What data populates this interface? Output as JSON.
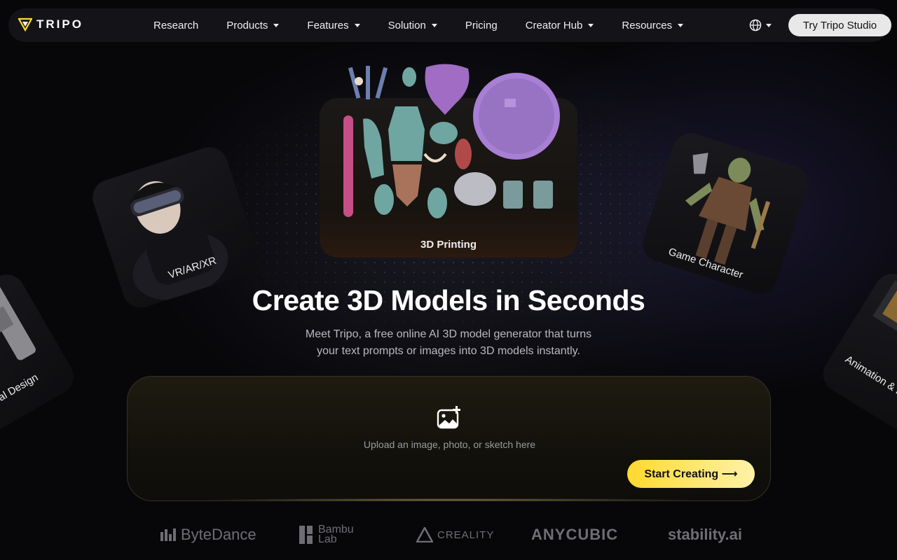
{
  "nav": {
    "logo_text": "TRIPO",
    "items": [
      {
        "label": "Research",
        "has_caret": false
      },
      {
        "label": "Products",
        "has_caret": true
      },
      {
        "label": "Features",
        "has_caret": true
      },
      {
        "label": "Solution",
        "has_caret": true
      },
      {
        "label": "Pricing",
        "has_caret": false
      },
      {
        "label": "Creator Hub",
        "has_caret": true
      },
      {
        "label": "Resources",
        "has_caret": true
      }
    ],
    "language_icon": "globe-icon",
    "cta_label": "Try Tripo Studio"
  },
  "showcase": {
    "main_card_label": "3D Printing",
    "vr_card_label": "VR/AR/XR",
    "game_card_label": "Game Character",
    "industrial_card_label": "Industrial Design",
    "animation_card_label": "Animation & F"
  },
  "hero": {
    "title": "Create 3D Models in Seconds",
    "subtitle": "Meet Tripo, a free online AI 3D model generator that turns your text prompts or images into 3D models instantly."
  },
  "upload": {
    "icon": "image-add-icon",
    "prompt": "Upload an image, photo, or sketch here",
    "start_label": "Start Creating ⟶"
  },
  "partners": [
    "ByteDance",
    "Bambu Lab",
    "CREALITY",
    "ANYCUBIC",
    "stability.ai"
  ],
  "colors": {
    "accent_yellow": "#ffd92e",
    "nav_bg": "#141418",
    "page_bg": "#07070a"
  }
}
